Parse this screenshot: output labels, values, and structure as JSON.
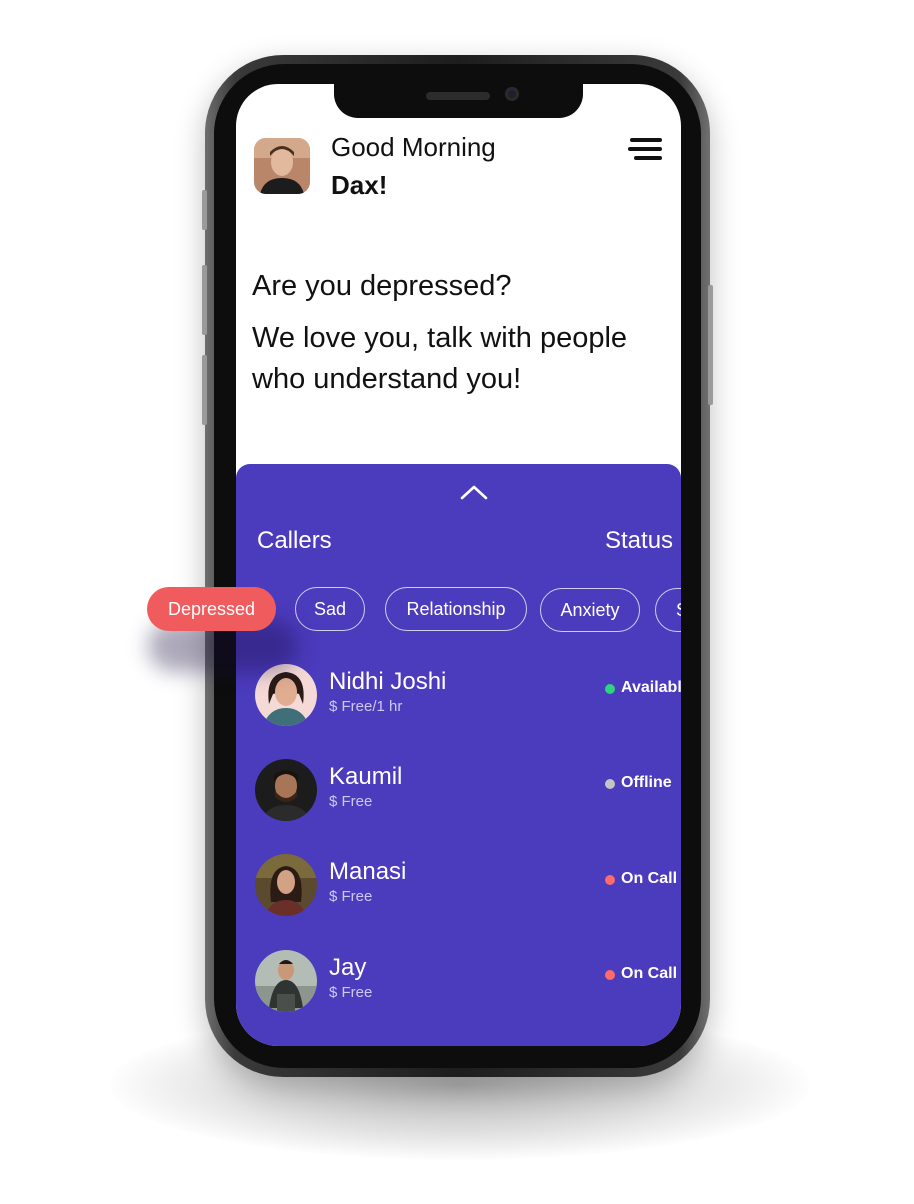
{
  "header": {
    "greeting": "Good Morning",
    "username": "Dax!"
  },
  "hero": {
    "headline": "Are you depressed?",
    "tagline": "We love you, talk with people who understand you!"
  },
  "sheet": {
    "callers_label": "Callers",
    "status_label": "Status",
    "active_filter": "Depressed",
    "filters": [
      "Sad",
      "Relationship",
      "Anxiety",
      "S"
    ]
  },
  "callers": [
    {
      "name": "Nidhi Joshi",
      "price": "$ Free/1 hr",
      "status": "Availabl",
      "status_color": "#2ed37e"
    },
    {
      "name": "Kaumil",
      "price": "$ Free",
      "status": "Offline",
      "status_color": "#c4c4c4"
    },
    {
      "name": "Manasi",
      "price": "$ Free",
      "status": "On Call",
      "status_color": "#ff6b6b"
    },
    {
      "name": "Jay",
      "price": "$ Free",
      "status": "On Call",
      "status_color": "#ff6b6b"
    }
  ],
  "colors": {
    "accent": "#4b3bbd",
    "active_chip": "#f05b5e"
  },
  "icons": {
    "menu": "hamburger-menu-icon",
    "collapse": "chevron-up-icon"
  }
}
